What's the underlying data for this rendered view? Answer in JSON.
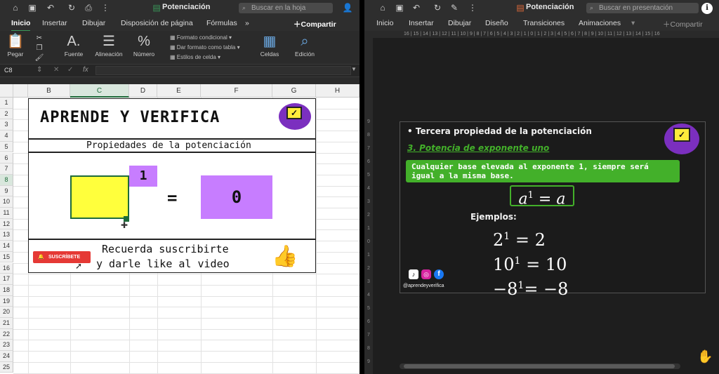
{
  "excel": {
    "title": "Potenciación",
    "search_placeholder": "Buscar en la hoja",
    "tabs": [
      "Inicio",
      "Insertar",
      "Dibujar",
      "Disposición de página",
      "Fórmulas"
    ],
    "more": "»",
    "share": "Compartir",
    "ribbon": {
      "paste": "Pegar",
      "font": "Fuente",
      "align": "Alineación",
      "number": "Número",
      "cond_format": "Formato condicional",
      "table_format": "Dar formato como tabla",
      "cell_styles": "Estilos de celda",
      "cells": "Celdas",
      "edit": "Edición"
    },
    "name_box": "C8",
    "fx": "fx",
    "columns": [
      "B",
      "C",
      "D",
      "E",
      "F",
      "G",
      "H"
    ],
    "rows": [
      "1",
      "2",
      "3",
      "4",
      "5",
      "6",
      "7",
      "8",
      "9",
      "10",
      "11",
      "12",
      "13",
      "14",
      "15",
      "16",
      "17",
      "18",
      "19",
      "20",
      "21",
      "22",
      "23",
      "24",
      "25"
    ],
    "content": {
      "heading": "APRENDE Y VERIFICA",
      "subheading": "Propiedades de la potenciación",
      "exponent": "1",
      "equals": "=",
      "result": "0",
      "subscribe_button": "SUSCRÍBETE",
      "reminder_line1": "Recuerda suscribirte",
      "reminder_line2": "y darle like al video"
    },
    "colors": {
      "yellow": "#ffff3c",
      "purple": "#c77dff",
      "accent": "#1e6b3a"
    }
  },
  "ppt": {
    "title": "Potenciación",
    "search_placeholder": "Buscar en presentación",
    "tabs": [
      "Inicio",
      "Insertar",
      "Dibujar",
      "Diseño",
      "Transiciones",
      "Animaciones"
    ],
    "share": "Compartir",
    "ruler_text": "16 | 15 | 14 | 13 | 12 | 11 | 10 | 9 | 8 | 7 | 6 | 5 | 4 | 3 | 2 | 1 | 0 | 1 | 2 | 3 | 4 | 5 | 6 | 7 | 8 | 9 | 10 | 11 | 12 | 13 | 14 | 15 | 16",
    "slide": {
      "bullet_title": "Tercera propiedad de la potenciación",
      "subtitle": "3. Potencia de exponente uno",
      "rule_text": "Cualquier base elevada al exponente 1, siempre será igual a la misma base.",
      "formula_base": "a",
      "formula_exp": "1",
      "formula_rhs": "= a",
      "examples_label": "Ejemplos:",
      "examples": [
        {
          "base": "2",
          "exp": "1",
          "rhs": "= 2"
        },
        {
          "base": "10",
          "exp": "1",
          "rhs": "= 10"
        },
        {
          "base": "−8",
          "exp": "1",
          "rhs": "= −8"
        }
      ],
      "handle": "@aprendeyverifica"
    },
    "colors": {
      "green": "#43b02a",
      "board": "#1b1b1b"
    }
  }
}
